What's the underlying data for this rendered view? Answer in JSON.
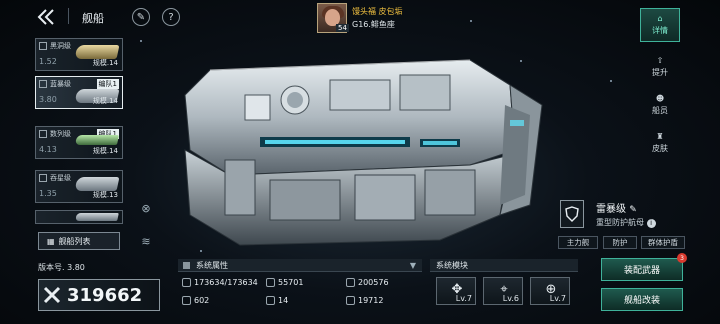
{
  "header": {
    "title": "舰船",
    "commander_name": "馒头福 皮包垢",
    "commander_level": "54",
    "location": "G16.鲱鱼座"
  },
  "ship_list": [
    {
      "name": "黑洞级",
      "num": "1.52",
      "scale": "规模.14",
      "fleet": ""
    },
    {
      "name": "蓝暴级",
      "num": "3.80",
      "scale": "规模.14",
      "fleet": "编队1"
    },
    {
      "name": "数列级",
      "num": "4.13",
      "scale": "规模.14",
      "fleet": "编队1"
    },
    {
      "name": "吞星级",
      "num": "1.35",
      "scale": "规模.13",
      "fleet": ""
    }
  ],
  "fleet_list_label": "舰船列表",
  "right_nav": [
    {
      "label": "详情",
      "icon": "detail-icon",
      "selected": true
    },
    {
      "label": "提升",
      "icon": "upgrade-icon",
      "selected": false
    },
    {
      "label": "船员",
      "icon": "crew-icon",
      "selected": false
    },
    {
      "label": "皮肤",
      "icon": "skin-icon",
      "selected": false
    }
  ],
  "ship_info": {
    "name": "雷暴级",
    "role": "重型防护航母",
    "tags": [
      "主力舰",
      "防护",
      "群体护盾"
    ]
  },
  "version_label": "版本号. 3.80",
  "power": "319662",
  "attributes": {
    "header": "系统属性",
    "items": [
      {
        "icon": "hull-icon",
        "value": "173634/173634"
      },
      {
        "icon": "armor-icon",
        "value": "55701"
      },
      {
        "icon": "shield-stat-icon",
        "value": "200576"
      },
      {
        "icon": "speed-icon",
        "value": "602"
      },
      {
        "icon": "slots-icon",
        "value": "14"
      },
      {
        "icon": "energy-icon",
        "value": "19712"
      }
    ]
  },
  "modules": {
    "header": "系统模块",
    "items": [
      {
        "icon": "crosshair-icon",
        "level": "Lv.7"
      },
      {
        "icon": "signal-icon",
        "level": "Lv.6"
      },
      {
        "icon": "target-icon",
        "level": "Lv.7"
      }
    ]
  },
  "actions": {
    "equip": "装配武器",
    "modify": "舰船改装",
    "badge": "3"
  },
  "colors": {
    "accent": "#3fb29a",
    "gold": "#f0c040",
    "alert": "#d93a2e"
  }
}
